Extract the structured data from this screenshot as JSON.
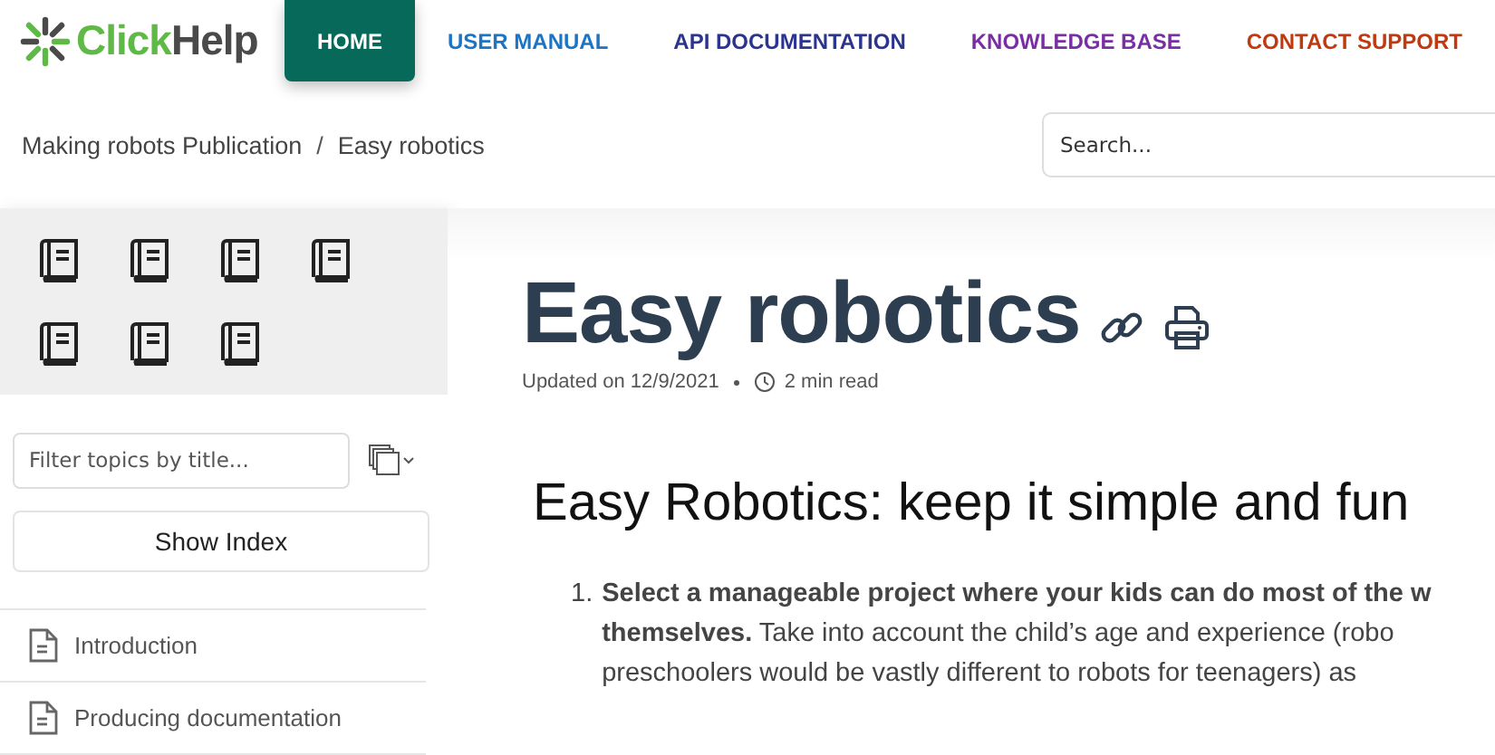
{
  "logo": {
    "text_1": "Click",
    "text_2": "Help"
  },
  "nav": [
    {
      "label": "HOME",
      "selected": true
    },
    {
      "label": "USER MANUAL",
      "selected": false,
      "color": "#1c74c4"
    },
    {
      "label": "API DOCUMENTATION",
      "selected": false,
      "color": "#2b3590"
    },
    {
      "label": "KNOWLEDGE BASE",
      "selected": false,
      "color": "#7a2ea3"
    },
    {
      "label": "CONTACT SUPPORT",
      "selected": false,
      "color": "#c1390e"
    }
  ],
  "breadcrumb": {
    "items": [
      "Making robots Publication",
      "Easy robotics"
    ],
    "separator": "/"
  },
  "search": {
    "placeholder": "Search..."
  },
  "sidebar": {
    "books": [
      {
        "kind": "book"
      },
      {
        "kind": "book"
      },
      {
        "kind": "book"
      },
      {
        "kind": "book"
      },
      {
        "kind": "book"
      },
      {
        "kind": "book"
      },
      {
        "kind": "book"
      }
    ],
    "filter": {
      "placeholder": "Filter topics by title..."
    },
    "show_index": "Show Index",
    "items": [
      {
        "label": "Introduction"
      },
      {
        "label": "Producing documentation"
      }
    ]
  },
  "article": {
    "title": "Easy robotics",
    "updated": "Updated on 12/9/2021",
    "read_time": "2 min read",
    "heading": "Easy Robotics: keep it simple and fun",
    "list": [
      {
        "number": "1.",
        "lines": [
          "**Select a manageable project where your kids can do most of the w**",
          "**themselves.** Take into account the child’s age and experience (robo",
          "preschoolers would be vastly different to robots for teenagers) as"
        ]
      }
    ]
  }
}
